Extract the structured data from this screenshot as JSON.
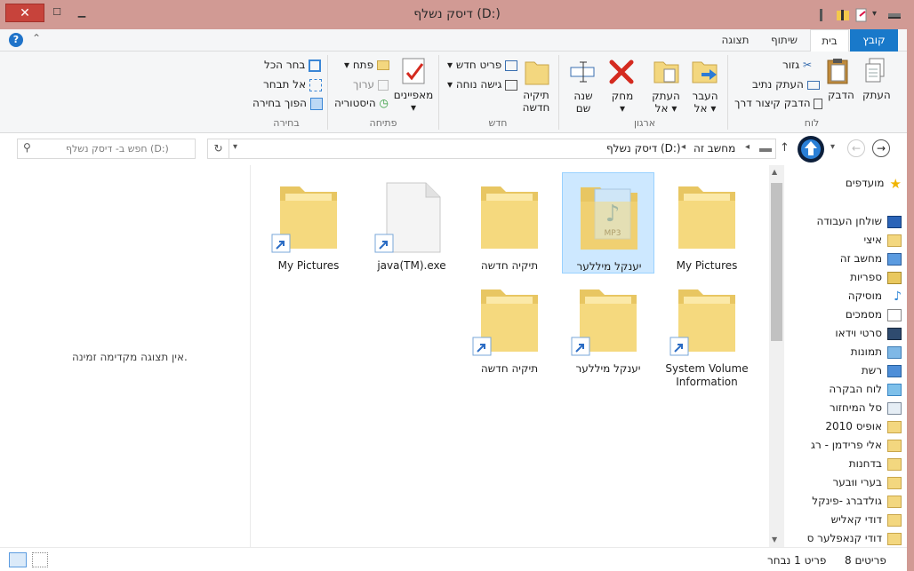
{
  "window": {
    "title": "דיסק נשלף (D:)"
  },
  "tabs": [
    "קובץ",
    "בית",
    "שיתוף",
    "תצוגה"
  ],
  "ribbon": {
    "clipboard": {
      "label": "לוח",
      "copy": "העתק",
      "paste": "הדבק",
      "cut": "גזור",
      "copy_path": "העתק נתיב",
      "paste_shortcut": "הדבק קיצור דרך"
    },
    "organize": {
      "label": "ארגון",
      "move_to": "העבר",
      "copy_to": "העתק",
      "to": "אל",
      "delete": "מחק",
      "rename_1": "שנה",
      "rename_2": "שם"
    },
    "new": {
      "label": "חדש",
      "new_folder_1": "תיקיה",
      "new_folder_2": "חדשה",
      "new_item": "פריט חדש",
      "easy_access": "גישה נוחה"
    },
    "open": {
      "label": "פתיחה",
      "properties": "מאפיינים",
      "open": "פתח",
      "edit": "ערוך",
      "history": "היסטוריה"
    },
    "select": {
      "label": "בחירה",
      "select_all": "בחר הכל",
      "select_none": "אל תבחר",
      "invert": "הפוך בחירה"
    }
  },
  "address": {
    "root": "מחשב זה",
    "drive": "דיסק נשלף (D:)"
  },
  "search": {
    "placeholder": "חפש ב- דיסק נשלף (D:)"
  },
  "preview_text": "אין תצוגה מקדימה זמינה.",
  "files": [
    {
      "name": "My Pictures"
    },
    {
      "name": "java(TM).exe"
    },
    {
      "name": "תיקיה חדשה"
    },
    {
      "name": "יענקל מיללער"
    },
    {
      "name": "My Pictures"
    },
    {
      "name": "תיקיה חדשה"
    },
    {
      "name": "יענקל מיללער"
    },
    {
      "name": "System Volume Information"
    }
  ],
  "nav": {
    "favorites": "מועדפים",
    "items": [
      "שולחן העבודה",
      "איצי",
      "מחשב זה",
      "ספריות",
      "מוסיקה",
      "מסמכים",
      "סרטי וידאו",
      "תמונות",
      "רשת",
      "לוח הבקרה",
      "סל המיחזור",
      "אופיס 2010",
      "אלי פרידמן - רג",
      "בדחנות",
      "בערי ווּבער",
      "גולדברג -פינקל",
      "דודי קאליש",
      "דודי קנאפלער ס"
    ]
  },
  "status": {
    "count": "8 פריטים",
    "selected": "פריט 1 נבחר"
  },
  "colors": {
    "titlebar": "#d19a94",
    "file_tab": "#1979ca",
    "selection": "#cde8ff",
    "folder": "#f3d77f"
  }
}
